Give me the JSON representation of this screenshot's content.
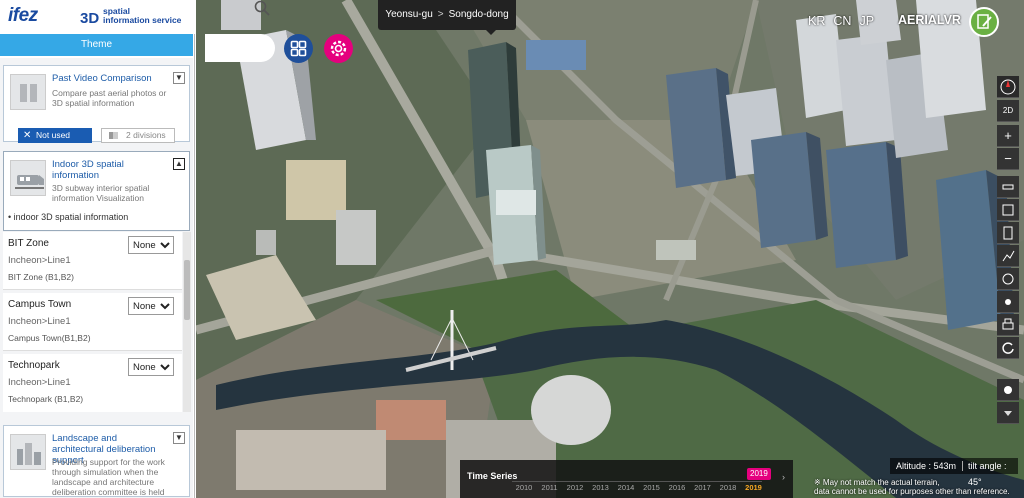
{
  "header": {
    "logo_brand": "ifez",
    "logo_3d": "3D",
    "logo_service_line1": "spatial",
    "logo_service_line2": "information service",
    "theme_tab": "Theme"
  },
  "cards": {
    "past_video": {
      "title": "Past Video Comparison",
      "desc": "Compare past aerial photos or 3D spatial information",
      "toggle": "▼",
      "not_used": "Not used",
      "two_divisions": "2 divisions"
    },
    "indoor": {
      "title": "Indoor 3D spatial information",
      "desc": "3D subway interior spatial information Visualization",
      "toggle": "▲",
      "item": "indoor 3D spatial information"
    },
    "landscape": {
      "title": "Landscape and architectural deliberation support",
      "desc": "Providing support for the work through simulation when the landscape and architecture deliberation committee is held",
      "toggle": "▼"
    }
  },
  "zones": [
    {
      "name": "BIT Zone",
      "line": "Incheon>Line1",
      "sub": "BIT Zone (B1,B2)",
      "selected": "None"
    },
    {
      "name": "Campus Town",
      "line": "Incheon>Line1",
      "sub": "Campus Town(B1,B2)",
      "selected": "None"
    },
    {
      "name": "Technopark",
      "line": "Incheon>Line1",
      "sub": "Technopark (B1,B2)",
      "selected": "None"
    }
  ],
  "map": {
    "breadcrumb_district": "Yeonsu-gu",
    "breadcrumb_sep": ">",
    "breadcrumb_dong": "Songdo-dong",
    "lang_kr": "KR",
    "lang_cn": "CN",
    "lang_jp": "JP",
    "aerial_vr": "AERIALVR",
    "altitude": "Altitude : 543m",
    "tilt": "tilt angle : 45°",
    "disclaimer_line1": "※ May not match the actual terrain,",
    "disclaimer_line2": "data cannot be used for purposes other than reference."
  },
  "toolbar": {
    "view_2d": "2D",
    "zoom_in": "+",
    "zoom_out": "−"
  },
  "timeseries": {
    "label": "Time Series",
    "current": "2019",
    "years": [
      "2010",
      "2011",
      "2012",
      "2013",
      "2014",
      "2015",
      "2016",
      "2017",
      "2018",
      "2019"
    ],
    "next": "›"
  },
  "colors": {
    "accent_blue": "#1a5cb2",
    "theme_tab": "#35a8e6",
    "magenta": "#e5007e",
    "navy_button": "#1f4f9a",
    "edit_green": "#6ab043"
  }
}
